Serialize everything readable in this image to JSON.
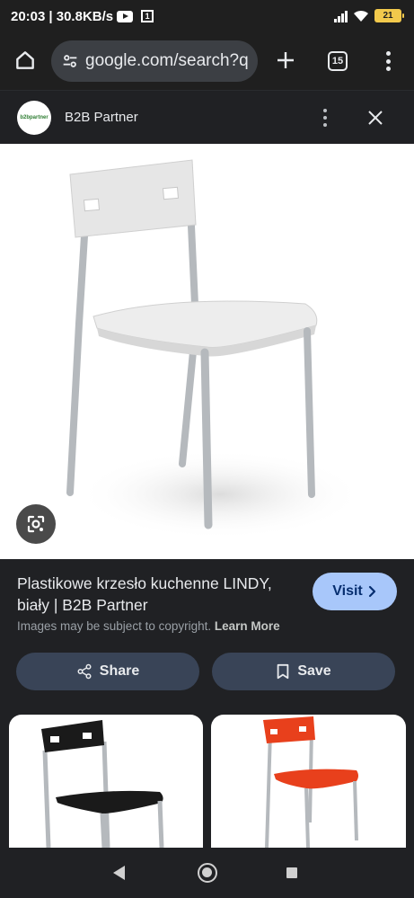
{
  "status_bar": {
    "time": "20:03",
    "speed": "30.8KB/s",
    "notification_box": "1",
    "battery": "21"
  },
  "browser": {
    "url": "google.com/search?q",
    "tab_count": "15"
  },
  "site": {
    "name": "B2B Partner",
    "logo_text": "b2bpartner"
  },
  "result": {
    "title": "Plastikowe krzesło kuchenne LINDY, biały | B2B Partner",
    "visit_label": "Visit",
    "copyright_text": "Images may be subject to copyright.",
    "learn_more": "Learn More",
    "share_label": "Share",
    "save_label": "Save"
  },
  "colors": {
    "accent": "#a8c7fa",
    "button_bg": "#394457",
    "chair_main": "#e6e6e6",
    "chair_black": "#1a1a1a",
    "chair_orange": "#e8401c"
  },
  "icons": [
    "home-icon",
    "tune-icon",
    "plus-icon",
    "tab-switcher-icon",
    "more-vert-icon",
    "close-icon",
    "lens-icon",
    "chevron-right-icon",
    "share-icon",
    "bookmark-icon"
  ]
}
